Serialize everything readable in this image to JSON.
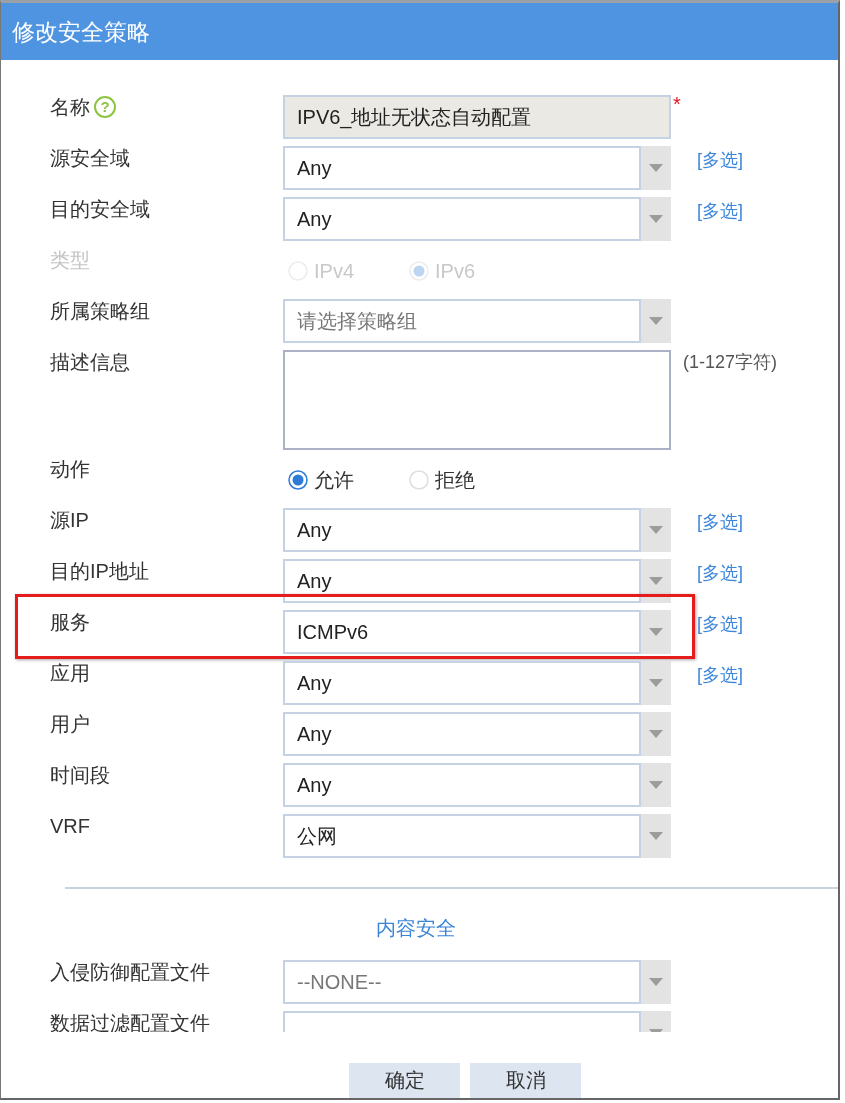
{
  "window": {
    "title": "修改安全策略"
  },
  "fields": [
    {
      "kind": "text",
      "label": "名称",
      "help": "?",
      "value": "IPV6_地址无状态自动配置",
      "readonly": true,
      "required_mark": "*",
      "disabled": false,
      "highlighted": false
    },
    {
      "kind": "select",
      "label": "源安全域",
      "value": "Any",
      "link": "[多选]",
      "disabled": false,
      "highlighted": false
    },
    {
      "kind": "select",
      "label": "目的安全域",
      "value": "Any",
      "link": "[多选]",
      "disabled": false,
      "highlighted": false
    },
    {
      "kind": "radio",
      "label": "类型",
      "options": [
        {
          "label": "IPv4",
          "selected": false
        },
        {
          "label": "IPv6",
          "selected": true
        }
      ],
      "disabled": true,
      "highlighted": false
    },
    {
      "kind": "select",
      "label": "所属策略组",
      "placeholder": "请选择策略组",
      "disabled": false,
      "highlighted": false
    },
    {
      "kind": "textarea",
      "label": "描述信息",
      "hint": "(1-127字符)",
      "disabled": false,
      "highlighted": false
    },
    {
      "kind": "radio",
      "label": "动作",
      "options": [
        {
          "label": "允许",
          "selected": true
        },
        {
          "label": "拒绝",
          "selected": false
        }
      ],
      "disabled": false,
      "highlighted": false
    },
    {
      "kind": "select",
      "label": "源IP",
      "value": "Any",
      "link": "[多选]",
      "disabled": false,
      "highlighted": false
    },
    {
      "kind": "select",
      "label": "目的IP地址",
      "value": "Any",
      "link": "[多选]",
      "disabled": false,
      "highlighted": false
    },
    {
      "kind": "select",
      "label": "服务",
      "value": "ICMPv6",
      "link": "[多选]",
      "disabled": false,
      "highlighted": true
    },
    {
      "kind": "select",
      "label": "应用",
      "value": "Any",
      "link": "[多选]",
      "disabled": false,
      "highlighted": false
    },
    {
      "kind": "select",
      "label": "用户",
      "value": "Any",
      "disabled": false,
      "highlighted": false
    },
    {
      "kind": "select",
      "label": "时间段",
      "value": "Any",
      "disabled": false,
      "highlighted": false
    },
    {
      "kind": "select",
      "label": "VRF",
      "value": "公网",
      "disabled": false,
      "highlighted": false
    }
  ],
  "section": {
    "title": "内容安全",
    "fields": [
      {
        "kind": "select",
        "label": "入侵防御配置文件",
        "placeholder": "--NONE--",
        "disabled": false,
        "highlighted": false
      },
      {
        "kind": "select",
        "label": "数据过滤配置文件",
        "disabled": false,
        "highlighted": false
      }
    ]
  },
  "buttons": [
    {
      "label": "确定"
    },
    {
      "label": "取消"
    }
  ]
}
